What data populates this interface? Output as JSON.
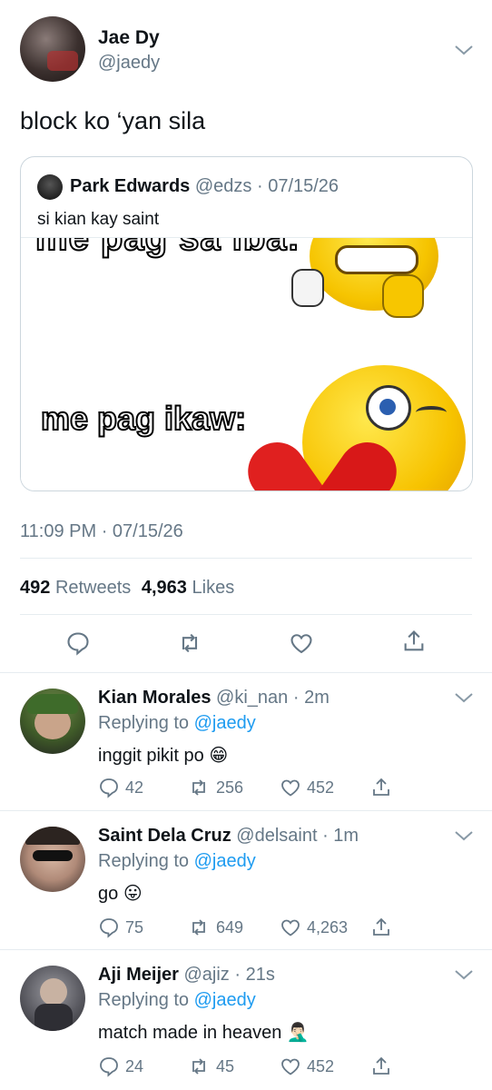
{
  "tweet": {
    "author_name": "Jae Dy",
    "author_handle": "@jaedy",
    "text": "block ko ‘yan sila",
    "time": "11:09 PM",
    "date_sep": "·",
    "date": "07/15/26",
    "retweet_count": "492",
    "retweet_label": "Retweets",
    "like_count": "4,963",
    "like_label": "Likes"
  },
  "quote": {
    "author_name": "Park Edwards",
    "author_handle": "@edzs",
    "date": "· 07/15/26",
    "text": "si kian kay saint",
    "meme_top_caption": "me pag sa iba:",
    "meme_bottom_caption": "me pag ikaw:"
  },
  "replies": [
    {
      "name": "Kian Morales",
      "handle": "@ki_nan",
      "time": "· 2m",
      "replying_prefix": "Replying to",
      "replying_to": "@jaedy",
      "text": "inggit pikit po",
      "emoji": "😁",
      "replies": "42",
      "retweets": "256",
      "likes": "452"
    },
    {
      "name": "Saint Dela Cruz",
      "handle": "@delsaint",
      "time": "· 1m",
      "replying_prefix": "Replying to",
      "replying_to": "@jaedy",
      "text": "go",
      "emoji": "😛",
      "replies": "75",
      "retweets": "649",
      "likes": "4,263"
    },
    {
      "name": "Aji Meijer",
      "handle": "@ajiz",
      "time": "· 21s",
      "replying_prefix": "Replying to",
      "replying_to": "@jaedy",
      "text": "match made in heaven",
      "emoji": "🤦🏻‍♂️",
      "replies": "24",
      "retweets": "45",
      "likes": "452"
    }
  ],
  "colors": {
    "link": "#1d9bf0",
    "secondary_text": "#657786",
    "divider": "#e6ecf0"
  },
  "icons": [
    "chevron-down-icon",
    "reply-icon",
    "retweet-icon",
    "like-icon",
    "share-icon"
  ]
}
